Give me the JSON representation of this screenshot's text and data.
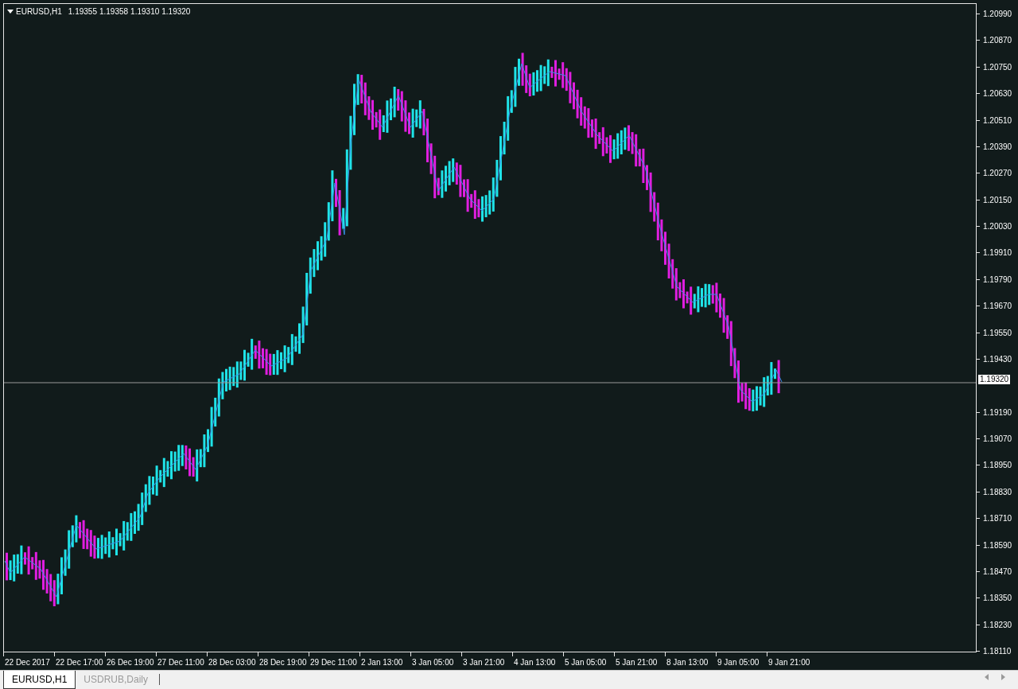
{
  "chart_header": {
    "symbol": "EURUSD,H1",
    "quotes": [
      "1.19355",
      "1.19358",
      "1.19310",
      "1.19320"
    ]
  },
  "price_axis": {
    "labels": [
      {
        "text": "1.20990",
        "kind": "tick"
      },
      {
        "text": "1.20870",
        "kind": "tick"
      },
      {
        "text": "1.20750",
        "kind": "tick"
      },
      {
        "text": "1.20630",
        "kind": "tick"
      },
      {
        "text": "1.20510",
        "kind": "tick"
      },
      {
        "text": "1.20390",
        "kind": "tick"
      },
      {
        "text": "1.20270",
        "kind": "tick"
      },
      {
        "text": "1.20150",
        "kind": "tick"
      },
      {
        "text": "1.20030",
        "kind": "tick"
      },
      {
        "text": "1.19910",
        "kind": "tick"
      },
      {
        "text": "1.19790",
        "kind": "tick"
      },
      {
        "text": "1.19670",
        "kind": "tick"
      },
      {
        "text": "1.19550",
        "kind": "tick"
      },
      {
        "text": "1.19430",
        "kind": "tick"
      },
      {
        "text": "1.19320",
        "kind": "current"
      },
      {
        "text": "1.19190",
        "kind": "tick"
      },
      {
        "text": "1.19070",
        "kind": "tick"
      },
      {
        "text": "1.18950",
        "kind": "tick"
      },
      {
        "text": "1.18830",
        "kind": "tick"
      },
      {
        "text": "1.18710",
        "kind": "tick"
      },
      {
        "text": "1.18590",
        "kind": "tick"
      },
      {
        "text": "1.18470",
        "kind": "tick"
      },
      {
        "text": "1.18350",
        "kind": "tick"
      },
      {
        "text": "1.18230",
        "kind": "tick"
      },
      {
        "text": "1.18110",
        "kind": "tick"
      }
    ]
  },
  "time_axis": {
    "labels": [
      "22 Dec 2017",
      "22 Dec 17:00",
      "26 Dec 19:00",
      "27 Dec 11:00",
      "28 Dec 03:00",
      "28 Dec 19:00",
      "29 Dec 11:00",
      "2 Jan 13:00",
      "3 Jan 05:00",
      "3 Jan 21:00",
      "4 Jan 13:00",
      "5 Jan 05:00",
      "5 Jan 21:00",
      "8 Jan 13:00",
      "9 Jan 05:00",
      "9 Jan 21:00"
    ]
  },
  "tabs": [
    {
      "label": "EURUSD,H1",
      "selected": true
    },
    {
      "label": "USDRUB,Daily",
      "selected": false
    }
  ]
}
